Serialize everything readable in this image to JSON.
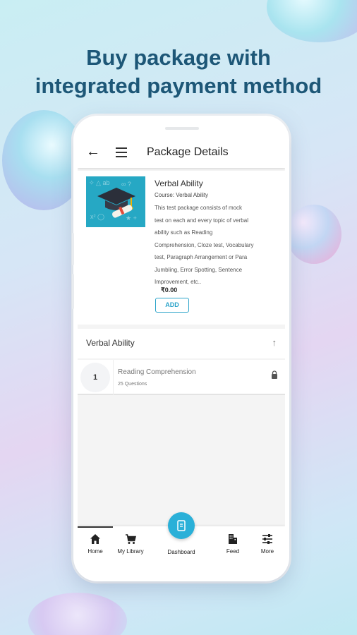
{
  "headline": {
    "line1": "Buy package with",
    "line2": "integrated payment method"
  },
  "appbar": {
    "back_icon": "arrow-left",
    "menu_icon": "hamburger",
    "title": "Package Details"
  },
  "package": {
    "image_icon": "graduation-cap-diploma",
    "title": "Verbal Ability",
    "course": "Course: Verbal Ability",
    "description_lines": [
      "This test package consists of mock",
      "test on each and every topic of verbal",
      "ability such as Reading",
      "Comprehension, Cloze test, Vocabulary",
      "test, Paragraph Arrangement or Para",
      "Jumbling, Error Spotting, Sentence",
      "Improvement, etc.."
    ],
    "price": "₹0.00",
    "add_label": "ADD"
  },
  "section": {
    "title": "Verbal Ability",
    "toggle_icon": "arrow-up"
  },
  "chapters": [
    {
      "number": "1",
      "name": "Reading Comprehension",
      "questions": "25 Questions",
      "status_icon": "lock"
    }
  ],
  "bottom_nav": {
    "items": [
      {
        "label": "Home",
        "icon": "home"
      },
      {
        "label": "My Library",
        "icon": "cart"
      },
      {
        "label": "Dashboard",
        "icon": "dashboard"
      },
      {
        "label": "Feed",
        "icon": "buildings"
      },
      {
        "label": "More",
        "icon": "sliders"
      }
    ],
    "active": "Home"
  },
  "colors": {
    "headline": "#1d5777",
    "accent": "#2aa3c9",
    "thumb_bg": "#26a8c4",
    "dashboard_button": "#2ab0d8"
  }
}
